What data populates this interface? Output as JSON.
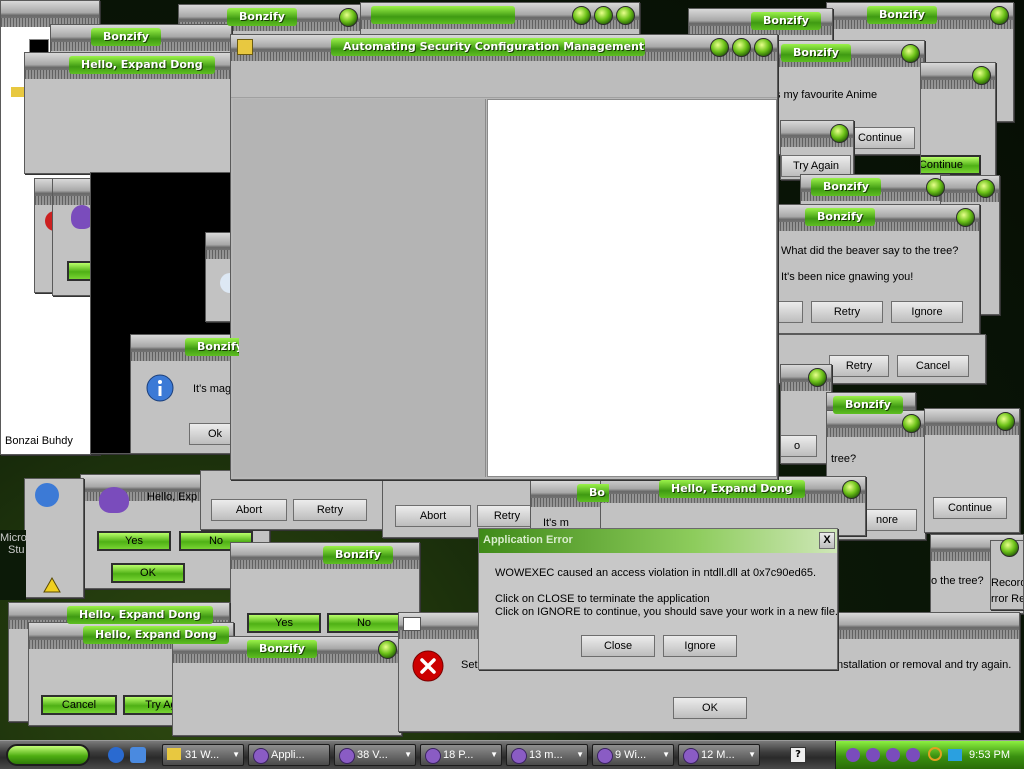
{
  "windows": {
    "bonzify": "Bonzify",
    "hello": "Hello, Expand Dong",
    "main": "Automating Security Configuration Management",
    "app_error": "Application Error"
  },
  "messages": {
    "anime": "s my favourite Anime",
    "beaver_q": "What did the beaver say to the tree?",
    "beaver_a": "It's been nice gnawing you!",
    "magic": "It's mag",
    "hello_exp": "Hello, Exp",
    "its_m": "It's m",
    "tree_short": "tree?",
    "o_tree": "o the tree?",
    "recor": "Record",
    "rror_re": "rror Re",
    "installation": "nstallation or removal and try again.",
    "micro": "Micro",
    "stu": "Stu",
    "set": "Set",
    "bonzai": "Bonzai Buhdy",
    "bo": "Bo"
  },
  "error_dialog": {
    "line1": "WOWEXEC caused an access violation in ntdll.dll at 0x7c90ed65.",
    "line2": "Click on CLOSE to terminate the application",
    "line3": "Click on IGNORE to continue, you should save your work in a new file."
  },
  "buttons": {
    "continue": "Continue",
    "try_again": "Try Again",
    "try_ag": "Try Ag",
    "retry": "Retry",
    "ignore": "Ignore",
    "cancel": "Cancel",
    "abort": "Abort",
    "yes": "Yes",
    "no": "No",
    "ok": "OK",
    "ok_short": "Ok",
    "close": "Close",
    "nore": "nore",
    "x": "X",
    "o": "o"
  },
  "taskbar": {
    "items": [
      "31 W...",
      "Appli...",
      "38 V...",
      "18 P...",
      "13 m...",
      "9 Wi...",
      "12 M..."
    ],
    "clock": "9:53 PM"
  },
  "colors": {
    "accent_green": "#4fb015",
    "window_gray": "#c2c2c2",
    "error_red": "#cc0000"
  }
}
